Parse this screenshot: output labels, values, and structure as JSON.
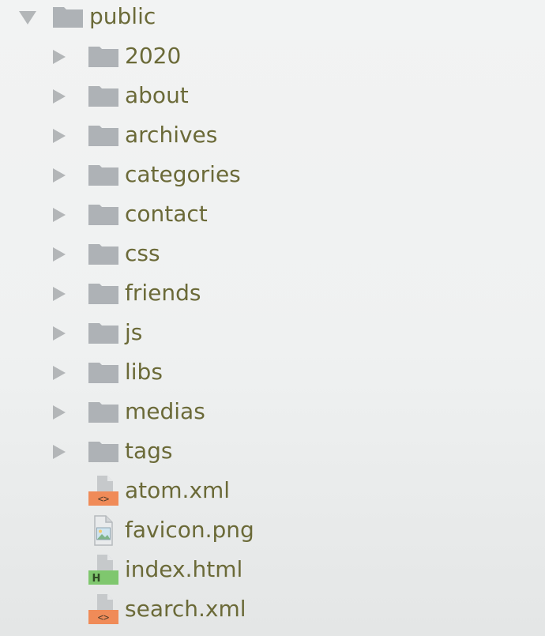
{
  "tree": {
    "root": {
      "label": "public",
      "expanded": true,
      "icon": "folder-icon",
      "arrow_icon": "chevron-down-icon"
    },
    "folders": [
      {
        "label": "2020",
        "icon": "folder-icon"
      },
      {
        "label": "about",
        "icon": "folder-icon"
      },
      {
        "label": "archives",
        "icon": "folder-icon"
      },
      {
        "label": "categories",
        "icon": "folder-icon"
      },
      {
        "label": "contact",
        "icon": "folder-icon"
      },
      {
        "label": "css",
        "icon": "folder-icon"
      },
      {
        "label": "friends",
        "icon": "folder-icon"
      },
      {
        "label": "js",
        "icon": "folder-icon"
      },
      {
        "label": "libs",
        "icon": "folder-icon"
      },
      {
        "label": "medias",
        "icon": "folder-icon"
      },
      {
        "label": "tags",
        "icon": "folder-icon"
      }
    ],
    "files": [
      {
        "label": "atom.xml",
        "type": "xml",
        "icon": "xml-file-icon",
        "badge_color": "#f08b58"
      },
      {
        "label": "favicon.png",
        "type": "image",
        "icon": "image-file-icon",
        "badge_color": "#6aa6c8"
      },
      {
        "label": "index.html",
        "type": "html",
        "icon": "html-file-icon",
        "badge_color": "#7fc76e"
      },
      {
        "label": "search.xml",
        "type": "xml",
        "icon": "xml-file-icon",
        "badge_color": "#f08b58"
      }
    ]
  },
  "colors": {
    "text": "#6b6a38",
    "folder": "#aeb2b6",
    "arrow": "#b3b6b8",
    "background": "#f0f1f1"
  }
}
